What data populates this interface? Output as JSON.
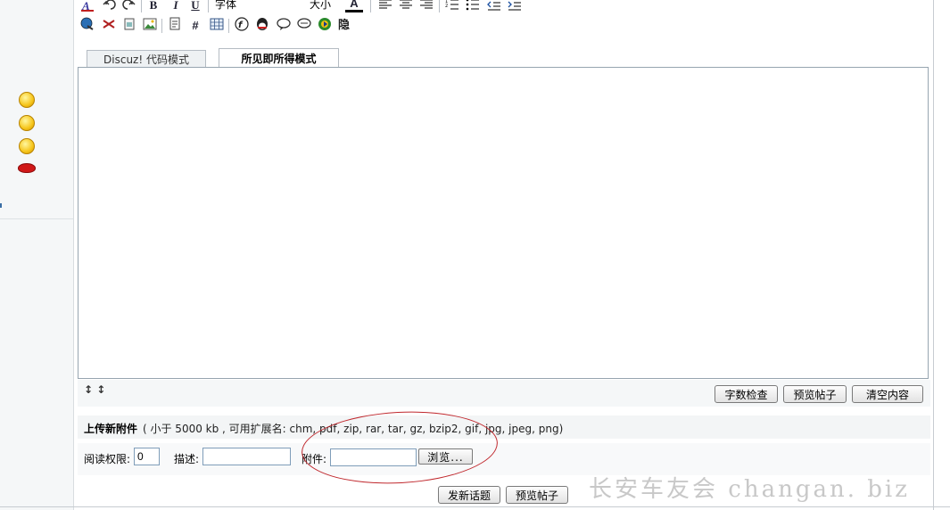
{
  "toolbar": {
    "row1": {
      "bold": "B",
      "italic": "I",
      "underline": "U",
      "font_select": "字体",
      "size_select": "大小",
      "color_letter": "A"
    }
  },
  "tabs": [
    {
      "label": "Discuz! 代码模式",
      "active": false
    },
    {
      "label": "所见即所得模式",
      "active": true
    }
  ],
  "editor": {
    "resize_glyph": "↕ ↕",
    "buttons": {
      "word_count": "字数检查",
      "preview": "预览帖子",
      "clear": "清空内容"
    }
  },
  "upload": {
    "title": "上传新附件",
    "note": "( 小于 5000 kb , 可用扩展名: chm, pdf, zip, rar, tar, gz, bzip2, gif, jpg, jpeg, png)",
    "read_perm_label": "阅读权限:",
    "read_perm_value": "0",
    "desc_label": "描述:",
    "desc_value": "",
    "attach_label": "附件:",
    "attach_value": "",
    "browse_label": "浏览..."
  },
  "actions": {
    "post_label": "发新话题",
    "preview_label": "预览帖子"
  },
  "watermark": "长安车友会 changan. biz",
  "colors": {
    "editor_border": "#97a5b0",
    "annotation_red": "#c0282d",
    "smiley_yellow": "#f6c51a",
    "lips_red": "#d01818"
  }
}
